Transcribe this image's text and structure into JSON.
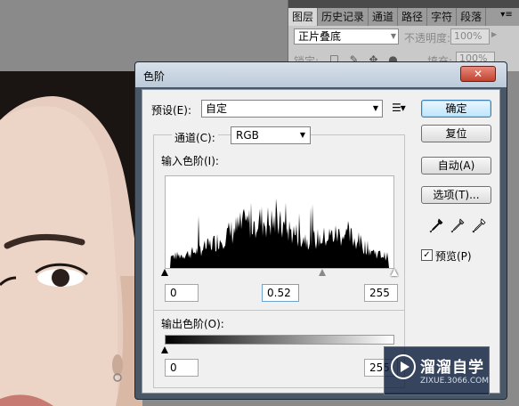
{
  "layers_panel": {
    "tabs": [
      "图层",
      "历史记录",
      "通道",
      "路径",
      "字符",
      "段落"
    ],
    "active_tab": 0,
    "blend_mode": "正片叠底",
    "opacity_label": "不透明度:",
    "opacity_value": "100%",
    "lock_label": "锁定:",
    "fill_label": "填充:",
    "fill_value": "100%"
  },
  "dialog": {
    "title": "色阶",
    "close_glyph": "✕",
    "preset_label": "预设(E):",
    "preset_value": "自定",
    "channel_label": "通道(C):",
    "channel_value": "RGB",
    "input_levels_label": "输入色阶(I):",
    "input_black": "0",
    "input_gamma": "0.52",
    "input_white": "255",
    "output_levels_label": "输出色阶(O):",
    "output_black": "0",
    "output_white": "255",
    "buttons": {
      "ok": "确定",
      "reset": "复位",
      "auto": "自动(A)",
      "options": "选项(T)..."
    },
    "preview_label": "预览(P)",
    "preview_checked": true
  },
  "watermark": {
    "title": "溜溜自学",
    "url": "ZIXUE.3066.COM"
  },
  "icons": {
    "panel_menu": "panel-menu-icon",
    "preset_menu": "preset-menu-icon",
    "eyedroppers": [
      "black-eyedropper-icon",
      "gray-eyedropper-icon",
      "white-eyedropper-icon"
    ]
  }
}
